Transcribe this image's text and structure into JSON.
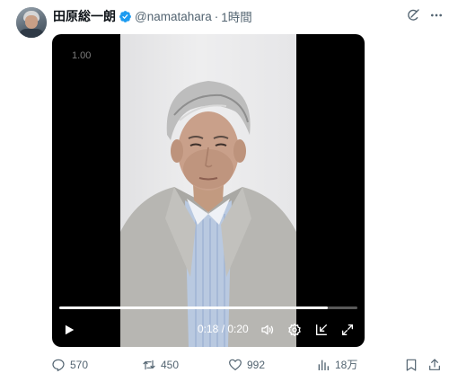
{
  "user": {
    "display_name": "田原総一朗",
    "handle": "@namatahara",
    "separator": "·",
    "time": "1時間",
    "verified_color": "#1d9bf0"
  },
  "video": {
    "speed_label": "1.00",
    "timecode": "0:18 / 0:20",
    "progress": 0.9,
    "icons": [
      "play-icon",
      "volume-icon",
      "settings-icon",
      "dock-icon",
      "fullscreen-icon"
    ]
  },
  "actions": {
    "replies": "570",
    "reposts": "450",
    "likes": "992",
    "views": "18万"
  },
  "colors": {
    "text_primary": "#0f1419",
    "text_secondary": "#536471",
    "accent": "#1d9bf0"
  }
}
